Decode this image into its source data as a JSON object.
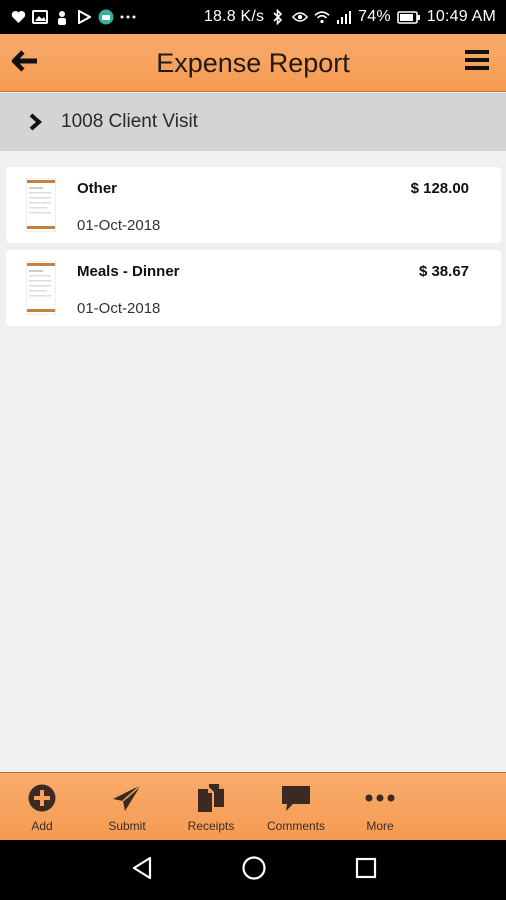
{
  "status_bar": {
    "speed": "18.8 K/s",
    "battery": "74%",
    "time": "10:49 AM",
    "icons_left": [
      "heart-icon",
      "image-icon",
      "person-icon",
      "play-icon",
      "app-icon",
      "more-dots-icon"
    ],
    "icons_right": [
      "bluetooth-icon",
      "eye-icon",
      "wifi-icon",
      "signal-icon",
      "battery-icon"
    ]
  },
  "header": {
    "title": "Expense Report",
    "back_icon": "arrow-left-icon",
    "menu_icon": "hamburger-menu-icon"
  },
  "report": {
    "title": "1008 Client Visit",
    "expand_icon": "chevron-right-icon"
  },
  "expenses": [
    {
      "name": "Other",
      "date": "01-Oct-2018",
      "amount": "$ 128.00",
      "icon": "receipt-thumbnail"
    },
    {
      "name": "Meals - Dinner",
      "date": "01-Oct-2018",
      "amount": "$ 38.67",
      "icon": "receipt-thumbnail"
    }
  ],
  "toolbar": {
    "items": [
      {
        "label": "Add",
        "icon": "plus-circle-icon"
      },
      {
        "label": "Submit",
        "icon": "paper-plane-icon"
      },
      {
        "label": "Receipts",
        "icon": "documents-icon"
      },
      {
        "label": "Comments",
        "icon": "speech-bubble-icon"
      },
      {
        "label": "More",
        "icon": "more-horizontal-icon"
      }
    ]
  },
  "nav": {
    "buttons": [
      "back-triangle-icon",
      "home-circle-icon",
      "recents-square-icon"
    ]
  },
  "colors": {
    "accent": "#f6a25e",
    "dark_icon": "#3a2a22",
    "background": "#f0f0f0",
    "report_header": "#d4d4d4"
  }
}
